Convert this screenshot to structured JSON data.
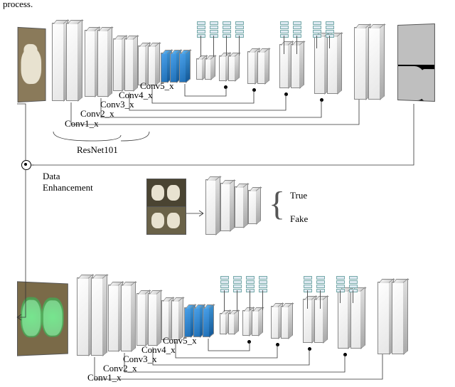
{
  "fragment_text": "process.",
  "top_network": {
    "backbone_label": "ResNet101",
    "conv_labels": [
      "Conv1_x",
      "Conv2_x",
      "Conv3_x",
      "Conv4_x",
      "Conv5_x"
    ]
  },
  "middle": {
    "data_enhancement": "Data\nEnhancement",
    "discriminator": {
      "true_label": "True",
      "fake_label": "Fake"
    }
  },
  "bottom_network": {
    "conv_labels": [
      "Conv1_x",
      "Conv2_x",
      "Conv3_x",
      "Conv4_x",
      "Conv5_x"
    ]
  }
}
